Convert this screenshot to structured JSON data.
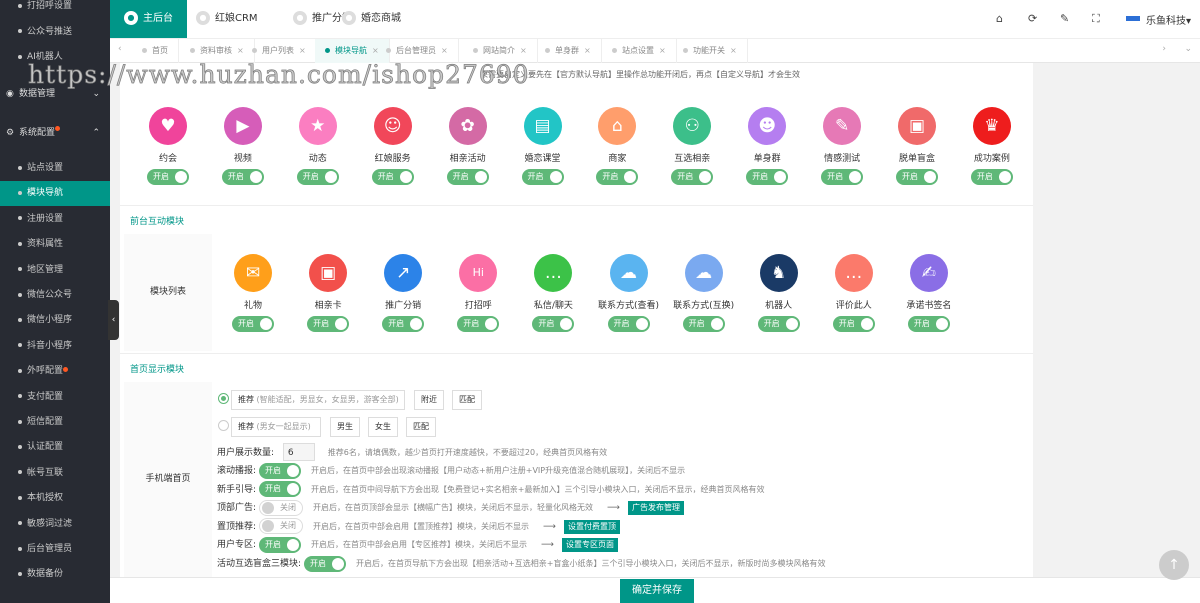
{
  "sidebar": {
    "items_top": [
      "打招呼设置",
      "公众号推送",
      "AI机器人"
    ],
    "section_data": "数据管理",
    "section_system": "系统配置",
    "items": [
      "站点设置",
      "模块导航",
      "注册设置",
      "资料属性",
      "地区管理",
      "微信公众号",
      "微信小程序",
      "抖音小程序",
      "外呼配置",
      "支付配置",
      "短信配置",
      "认证配置",
      "帐号互联",
      "本机授权",
      "敏感词过滤",
      "后台管理员",
      "数据备份"
    ],
    "active": "模块导航"
  },
  "header": {
    "tabs": [
      "主后台",
      "红娘CRM",
      "推广分销",
      "婚恋商城"
    ],
    "user": "乐鱼科技"
  },
  "page_tabs": [
    "首页",
    "资料审核",
    "用户列表",
    "模块导航",
    "后台管理员",
    "网站简介",
    "单身群",
    "站点设置",
    "功能开关"
  ],
  "notice": "果需要自定义要先在【官方默认导航】里操作总功能开闭后，再点【自定义导航】才会生效",
  "watermark": "https://www.huzhan.com/ishop27690",
  "toggle_on": "开启",
  "toggle_off": "关闭",
  "nav_modules": [
    {
      "label": "约会",
      "color": "#f0449b",
      "icon": "♥"
    },
    {
      "label": "视频",
      "color": "#d65db9",
      "icon": "▶"
    },
    {
      "label": "动态",
      "color": "#fb7ec1",
      "icon": "★"
    },
    {
      "label": "红娘服务",
      "color": "#f1475a",
      "icon": "☺"
    },
    {
      "label": "相亲活动",
      "color": "#d46aa5",
      "icon": "✿"
    },
    {
      "label": "婚恋课堂",
      "color": "#22c5c6",
      "icon": "▤"
    },
    {
      "label": "商家",
      "color": "#ff9e6c",
      "icon": "⌂"
    },
    {
      "label": "互选相亲",
      "color": "#3cbf8a",
      "icon": "⚇"
    },
    {
      "label": "单身群",
      "color": "#b57ef0",
      "icon": "☻"
    },
    {
      "label": "情感测试",
      "color": "#e679b6",
      "icon": "✎"
    },
    {
      "label": "脱单盲盒",
      "color": "#f06a6a",
      "icon": "▣"
    },
    {
      "label": "成功案例",
      "color": "#ee1d1d",
      "icon": "♛"
    }
  ],
  "interact_section": "前台互动模块",
  "interact_label": "模块列表",
  "interact_modules": [
    {
      "label": "礼物",
      "color": "#ff9f1a",
      "icon": "✉"
    },
    {
      "label": "相亲卡",
      "color": "#f2504b",
      "icon": "▣"
    },
    {
      "label": "推广分销",
      "color": "#2c83e8",
      "icon": "↗"
    },
    {
      "label": "打招呼",
      "color": "#fb6fa5",
      "icon": "Hi"
    },
    {
      "label": "私信/聊天",
      "color": "#3cc248",
      "icon": "…"
    },
    {
      "label": "联系方式(查看)",
      "color": "#5ab4f0",
      "icon": "☁"
    },
    {
      "label": "联系方式(互换)",
      "color": "#7aa9f0",
      "icon": "☁"
    },
    {
      "label": "机器人",
      "color": "#1a3a66",
      "icon": "♞"
    },
    {
      "label": "评价此人",
      "color": "#fb7a6b",
      "icon": "…"
    },
    {
      "label": "承诺书签名",
      "color": "#8a6ee6",
      "icon": "✍"
    }
  ],
  "home_section": "首页显示模块",
  "home_label": "手机端首页",
  "home": {
    "opt1_value": "推荐",
    "opt1_hint": "(智能适配，男显女，女显男，游客全部)",
    "opt1_btns": [
      "附近",
      "匹配"
    ],
    "opt2_value": "推荐",
    "opt2_hint": "(男女一起显示)",
    "opt2_btns": [
      "男生",
      "女生",
      "匹配"
    ],
    "count_label": "用户展示数量:",
    "count_value": "6",
    "count_desc": "推荐6名，请填偶数，越少首页打开速度越快，不要超过20，经典首页风格有效",
    "rows": [
      {
        "label": "滚动播报:",
        "on": true,
        "desc": "开启后，在首页中部会出现滚动播报【用户动态+新用户注册+VIP升级充值混合随机展现】，关闭后不显示"
      },
      {
        "label": "新手引导:",
        "on": true,
        "desc": "开启后，在首页中间导航下方会出现【免费登记+实名相亲+最新加入】三个引导小模块入口，关闭后不显示，经典首页风格有效"
      },
      {
        "label": "顶部广告:",
        "on": false,
        "desc": "开启后，在首页顶部会显示【横幅广告】模块，关闭后不显示，轻量化风格无效",
        "link": "广告发布管理"
      },
      {
        "label": "置顶推荐:",
        "on": false,
        "desc": "开启后，在首页中部会启用【置顶推荐】模块，关闭后不显示",
        "link": "设置付费置顶"
      },
      {
        "label": "用户专区:",
        "on": true,
        "desc": "开启后，在首页中部会启用【专区推荐】模块，关闭后不显示",
        "link": "设置专区页面"
      },
      {
        "label": "活动互选盲盒三模块:",
        "on": true,
        "desc": "开启后，在首页导航下方会出现【相亲活动+互选相亲+盲盒小纸条】三个引导小模块入口，关闭后不显示，新版时尚多模块风格有效"
      }
    ]
  },
  "save_label": "确定并保存"
}
